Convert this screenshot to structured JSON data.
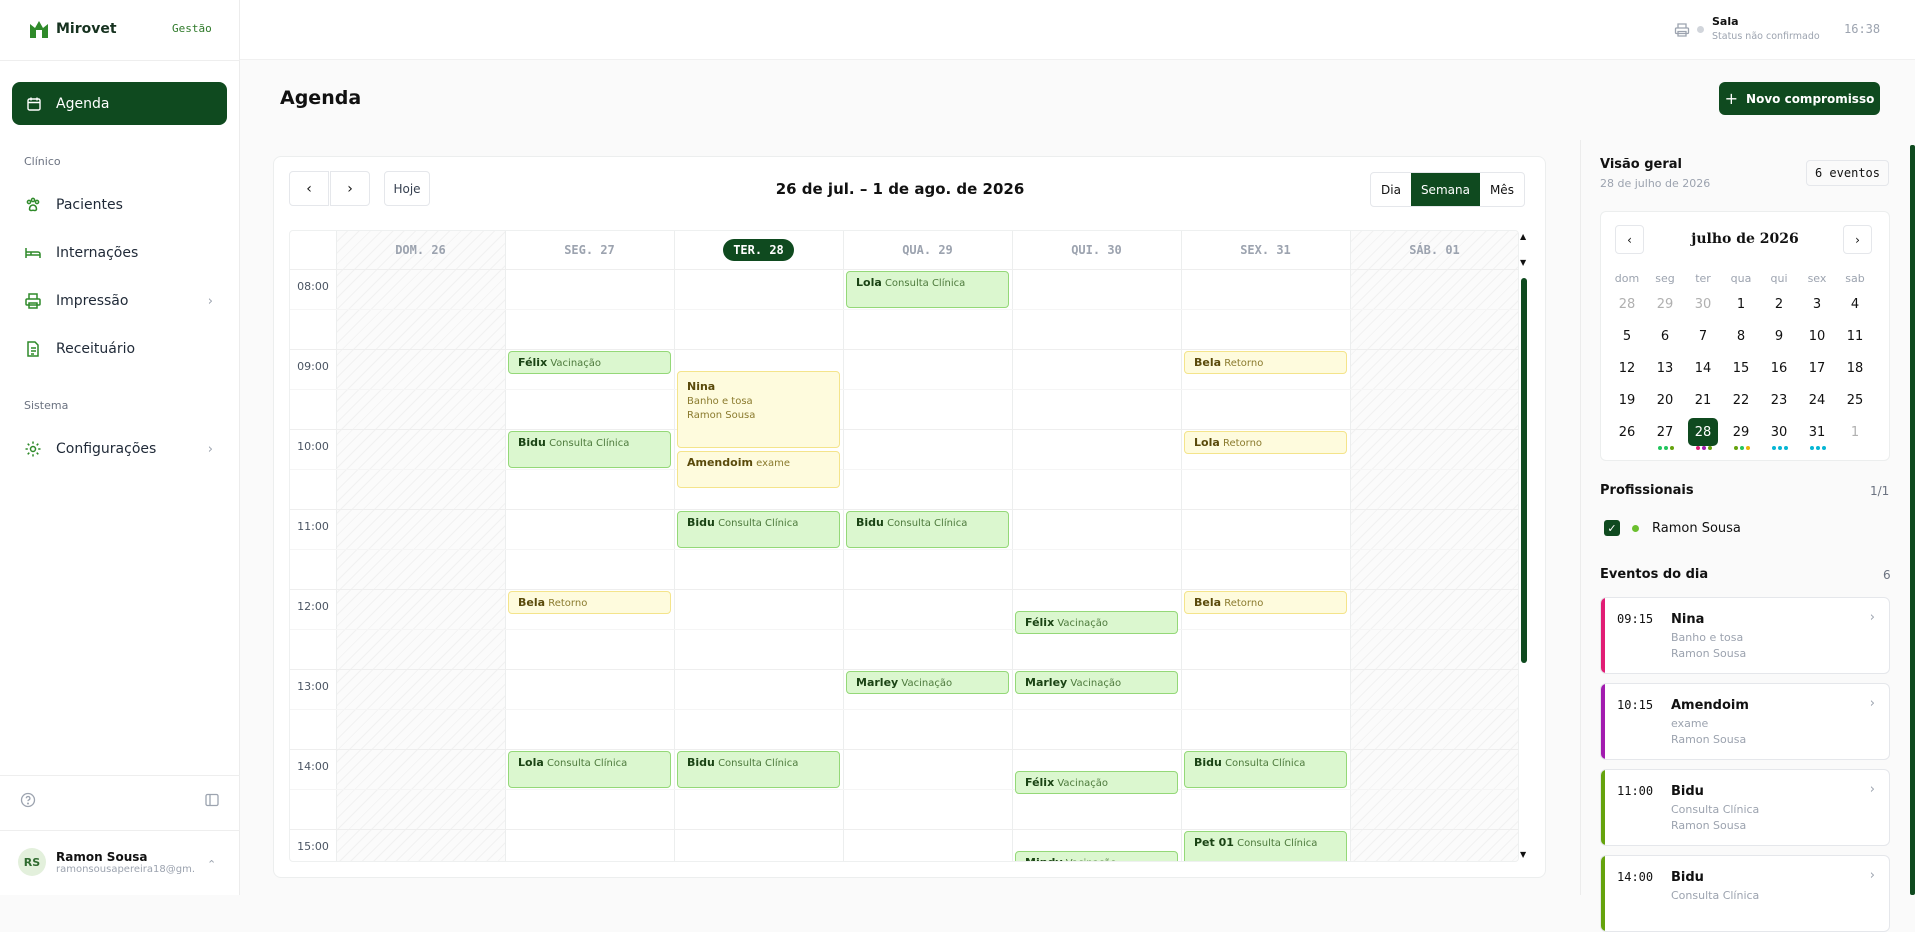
{
  "app": {
    "name": "Mirovet",
    "badge": "Gestão"
  },
  "sidebar": {
    "active": "Agenda",
    "section_clinico": "Clínico",
    "items_clinico": [
      {
        "label": "Pacientes",
        "icon": "paw-icon"
      },
      {
        "label": "Internações",
        "icon": "bed-icon"
      },
      {
        "label": "Impressão",
        "icon": "printer-icon",
        "has_submenu": true
      },
      {
        "label": "Receituário",
        "icon": "document-icon"
      }
    ],
    "section_sistema": "Sistema",
    "items_sistema": [
      {
        "label": "Configurações",
        "icon": "gear-icon",
        "has_submenu": true
      }
    ],
    "user": {
      "initials": "RS",
      "name": "Ramon Sousa",
      "email": "ramonsousapereira18@gm..."
    }
  },
  "topbar": {
    "room": "Sala",
    "status": "Status não confirmado",
    "time": "16:38"
  },
  "page": {
    "title": "Agenda",
    "new_button": "Novo compromisso"
  },
  "calendar": {
    "today_label": "Hoje",
    "range": "26 de jul. – 1 de ago. de 2026",
    "views": [
      "Dia",
      "Semana",
      "Mês"
    ],
    "active_view": "Semana",
    "days": [
      "DOM. 26",
      "SEG. 27",
      "TER. 28",
      "QUA. 29",
      "QUI. 30",
      "SEX. 31",
      "SÁB. 01"
    ],
    "today_index": 2,
    "hours": [
      "08:00",
      "09:00",
      "10:00",
      "11:00",
      "12:00",
      "13:00",
      "14:00",
      "15:00"
    ],
    "events": [
      {
        "day": 3,
        "start": 8.0,
        "end": 8.5,
        "name": "Lola",
        "type": "Consulta Clínica",
        "kind": "g"
      },
      {
        "day": 1,
        "start": 9.0,
        "end": 9.33,
        "name": "Félix",
        "type": "Vacinação",
        "kind": "g"
      },
      {
        "day": 5,
        "start": 9.0,
        "end": 9.33,
        "name": "Bela",
        "type": "Retorno",
        "kind": "y"
      },
      {
        "day": 2,
        "start": 9.25,
        "end": 10.25,
        "name": "Nina",
        "detail1": "Banho e tosa",
        "detail2": "Ramon Sousa",
        "kind": "y"
      },
      {
        "day": 1,
        "start": 10.0,
        "end": 10.5,
        "name": "Bidu",
        "type": "Consulta Clínica",
        "kind": "g"
      },
      {
        "day": 5,
        "start": 10.0,
        "end": 10.33,
        "name": "Lola",
        "type": "Retorno",
        "kind": "y"
      },
      {
        "day": 2,
        "start": 10.25,
        "end": 10.75,
        "name": "Amendoim",
        "type": "exame",
        "kind": "y"
      },
      {
        "day": 2,
        "start": 11.0,
        "end": 11.5,
        "name": "Bidu",
        "type": "Consulta Clínica",
        "kind": "g"
      },
      {
        "day": 3,
        "start": 11.0,
        "end": 11.5,
        "name": "Bidu",
        "type": "Consulta Clínica",
        "kind": "g"
      },
      {
        "day": 1,
        "start": 12.0,
        "end": 12.33,
        "name": "Bela",
        "type": "Retorno",
        "kind": "y"
      },
      {
        "day": 5,
        "start": 12.0,
        "end": 12.33,
        "name": "Bela",
        "type": "Retorno",
        "kind": "y"
      },
      {
        "day": 4,
        "start": 12.25,
        "end": 12.58,
        "name": "Félix",
        "type": "Vacinação",
        "kind": "g"
      },
      {
        "day": 3,
        "start": 13.0,
        "end": 13.33,
        "name": "Marley",
        "type": "Vacinação",
        "kind": "g"
      },
      {
        "day": 4,
        "start": 13.0,
        "end": 13.33,
        "name": "Marley",
        "type": "Vacinação",
        "kind": "g"
      },
      {
        "day": 1,
        "start": 14.0,
        "end": 14.5,
        "name": "Lola",
        "type": "Consulta Clínica",
        "kind": "g"
      },
      {
        "day": 2,
        "start": 14.0,
        "end": 14.5,
        "name": "Bidu",
        "type": "Consulta Clínica",
        "kind": "g"
      },
      {
        "day": 5,
        "start": 14.0,
        "end": 14.5,
        "name": "Bidu",
        "type": "Consulta Clínica",
        "kind": "g"
      },
      {
        "day": 4,
        "start": 14.25,
        "end": 14.58,
        "name": "Félix",
        "type": "Vacinação",
        "kind": "g"
      },
      {
        "day": 5,
        "start": 15.0,
        "end": 15.5,
        "name": "Pet 01",
        "type": "Consulta Clínica",
        "kind": "g"
      },
      {
        "day": 4,
        "start": 15.25,
        "end": 15.58,
        "name": "Mindy",
        "type": "Vacinação",
        "kind": "g"
      }
    ]
  },
  "overview": {
    "title": "Visão geral",
    "date": "28 de julho de 2026",
    "count": "6 eventos",
    "mini": {
      "title": "julho de 2026",
      "weekdays": [
        "dom",
        "seg",
        "ter",
        "qua",
        "qui",
        "sex",
        "sab"
      ],
      "days": [
        [
          "28",
          "29",
          "30",
          "1",
          "2",
          "3",
          "4"
        ],
        [
          "5",
          "6",
          "7",
          "8",
          "9",
          "10",
          "11"
        ],
        [
          "12",
          "13",
          "14",
          "15",
          "16",
          "17",
          "18"
        ],
        [
          "19",
          "20",
          "21",
          "22",
          "23",
          "24",
          "25"
        ],
        [
          "26",
          "27",
          "28",
          "29",
          "30",
          "31",
          "1"
        ]
      ],
      "selected": "28"
    },
    "prof_title": "Profissionais",
    "prof_count": "1/1",
    "prof_name": "Ramon Sousa",
    "events_title": "Eventos do dia",
    "events_count": "6",
    "day_events": [
      {
        "time": "09:15",
        "name": "Nina",
        "l1": "Banho e tosa",
        "l2": "Ramon Sousa",
        "color": "#e11d74"
      },
      {
        "time": "10:15",
        "name": "Amendoim",
        "l1": "exame",
        "l2": "Ramon Sousa",
        "color": "#a21caf"
      },
      {
        "time": "11:00",
        "name": "Bidu",
        "l1": "Consulta Clínica",
        "l2": "Ramon Sousa",
        "color": "#65a30d"
      },
      {
        "time": "14:00",
        "name": "Bidu",
        "l1": "Consulta Clínica",
        "l2": "",
        "color": "#65a30d"
      }
    ]
  }
}
